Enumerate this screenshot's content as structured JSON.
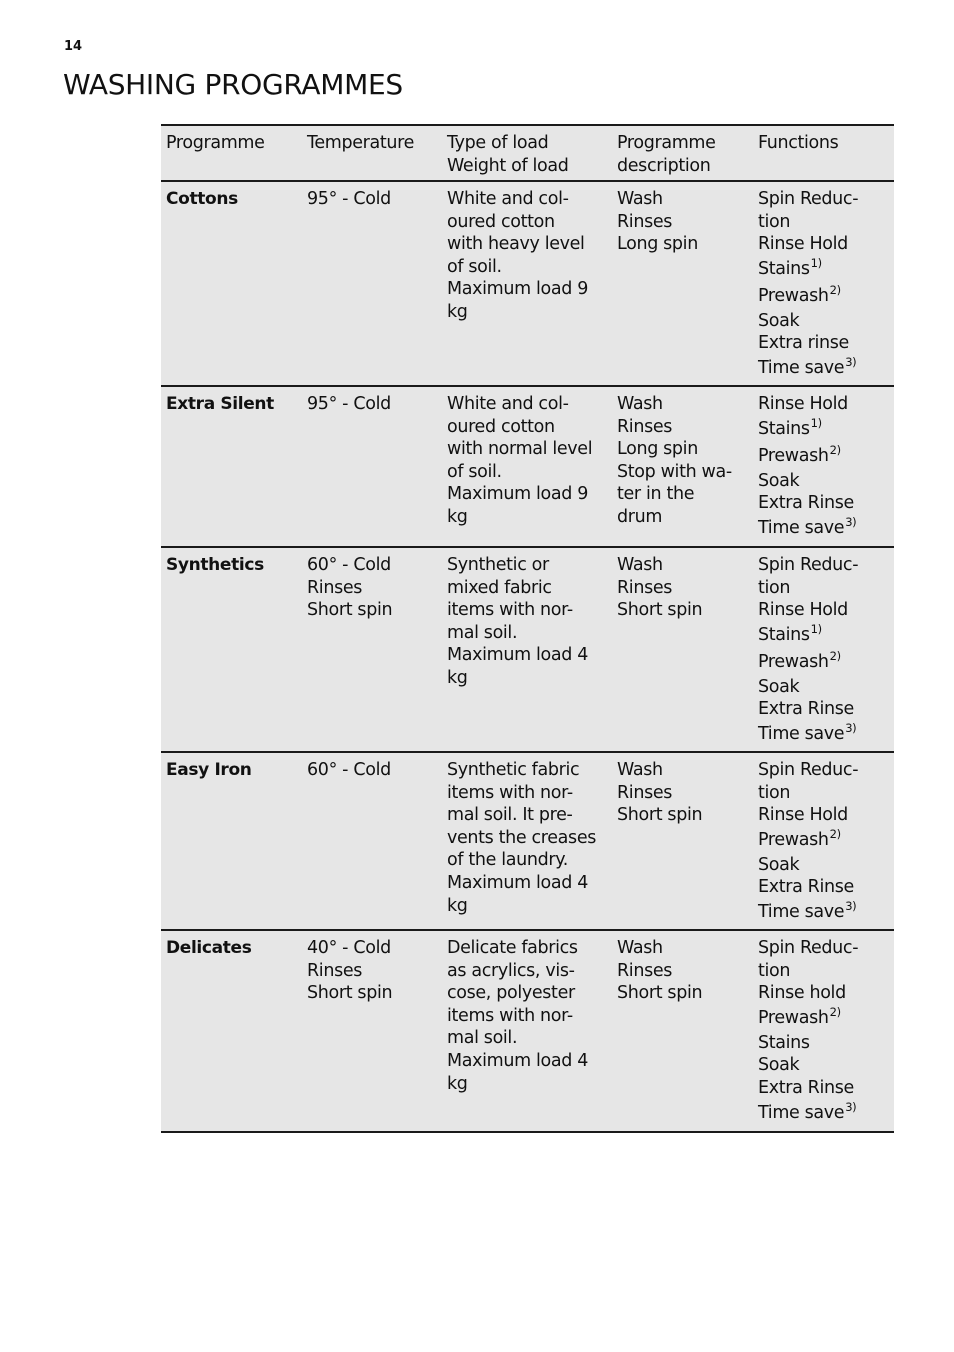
{
  "page": {
    "number": "14",
    "title": "WASHING PROGRAMMES"
  },
  "table": {
    "headers": [
      [
        "Programme"
      ],
      [
        "Temperature"
      ],
      [
        "Type of load",
        "Weight of load"
      ],
      [
        "Programme",
        "description"
      ],
      [
        "Functions"
      ]
    ],
    "rows": [
      {
        "programme": "Cottons",
        "temperature": [
          "95° - Cold"
        ],
        "load": [
          "White and col-",
          "oured cotton",
          "with heavy level",
          "of soil.",
          "Maximum load 9",
          "kg"
        ],
        "description": [
          "Wash",
          "Rinses",
          "Long spin"
        ],
        "functions": [
          {
            "text": "Spin Reduc-",
            "note": ""
          },
          {
            "text": "tion",
            "note": ""
          },
          {
            "text": "Rinse Hold",
            "note": ""
          },
          {
            "text": "Stains",
            "note": "1)"
          },
          {
            "text": "Prewash",
            "note": "2)"
          },
          {
            "text": "Soak",
            "note": ""
          },
          {
            "text": "Extra rinse",
            "note": ""
          },
          {
            "text": "Time save",
            "note": "3)"
          }
        ]
      },
      {
        "programme": "Extra Silent",
        "temperature": [
          "95° - Cold"
        ],
        "load": [
          "White and col-",
          "oured cotton",
          "with normal level",
          "of soil.",
          "Maximum load 9",
          "kg"
        ],
        "description": [
          "Wash",
          "Rinses",
          "Long spin",
          "Stop with wa-",
          "ter in the",
          "drum"
        ],
        "functions": [
          {
            "text": "Rinse Hold",
            "note": ""
          },
          {
            "text": "Stains",
            "note": "1)"
          },
          {
            "text": "Prewash",
            "note": "2)"
          },
          {
            "text": "Soak",
            "note": ""
          },
          {
            "text": "Extra Rinse",
            "note": ""
          },
          {
            "text": "Time save",
            "note": "3)"
          }
        ]
      },
      {
        "programme": "Synthetics",
        "temperature": [
          "60° - Cold",
          "Rinses",
          "Short spin"
        ],
        "load": [
          "Synthetic or",
          "mixed fabric",
          "items with nor-",
          "mal soil.",
          "Maximum load 4",
          "kg"
        ],
        "description": [
          "Wash",
          "Rinses",
          "Short spin"
        ],
        "functions": [
          {
            "text": "Spin Reduc-",
            "note": ""
          },
          {
            "text": "tion",
            "note": ""
          },
          {
            "text": "Rinse Hold",
            "note": ""
          },
          {
            "text": "Stains",
            "note": "1)"
          },
          {
            "text": "Prewash",
            "note": "2)"
          },
          {
            "text": "Soak",
            "note": ""
          },
          {
            "text": "Extra Rinse",
            "note": ""
          },
          {
            "text": "Time save",
            "note": "3)"
          }
        ]
      },
      {
        "programme": "Easy Iron",
        "temperature": [
          "60° - Cold"
        ],
        "load": [
          "Synthetic fabric",
          "items with nor-",
          "mal soil. It pre-",
          "vents the creases",
          "of the laundry.",
          "Maximum load 4",
          "kg"
        ],
        "description": [
          "Wash",
          "Rinses",
          "Short spin"
        ],
        "functions": [
          {
            "text": "Spin Reduc-",
            "note": ""
          },
          {
            "text": "tion",
            "note": ""
          },
          {
            "text": "Rinse Hold",
            "note": ""
          },
          {
            "text": "Prewash",
            "note": "2)"
          },
          {
            "text": "Soak",
            "note": ""
          },
          {
            "text": "Extra Rinse",
            "note": ""
          },
          {
            "text": "Time save",
            "note": "3)"
          }
        ]
      },
      {
        "programme": "Delicates",
        "temperature": [
          "40° - Cold",
          "Rinses",
          "Short spin"
        ],
        "load": [
          "Delicate fabrics",
          "as acrylics, vis-",
          "cose, polyester",
          "items with nor-",
          "mal soil.",
          "Maximum load 4",
          "kg"
        ],
        "description": [
          "Wash",
          "Rinses",
          "Short spin"
        ],
        "functions": [
          {
            "text": "Spin Reduc-",
            "note": ""
          },
          {
            "text": "tion",
            "note": ""
          },
          {
            "text": "Rinse hold",
            "note": ""
          },
          {
            "text": "Prewash",
            "note": "2)"
          },
          {
            "text": "Stains",
            "note": ""
          },
          {
            "text": "Soak",
            "note": ""
          },
          {
            "text": "Extra Rinse",
            "note": ""
          },
          {
            "text": "Time save",
            "note": "3)"
          }
        ]
      }
    ]
  }
}
